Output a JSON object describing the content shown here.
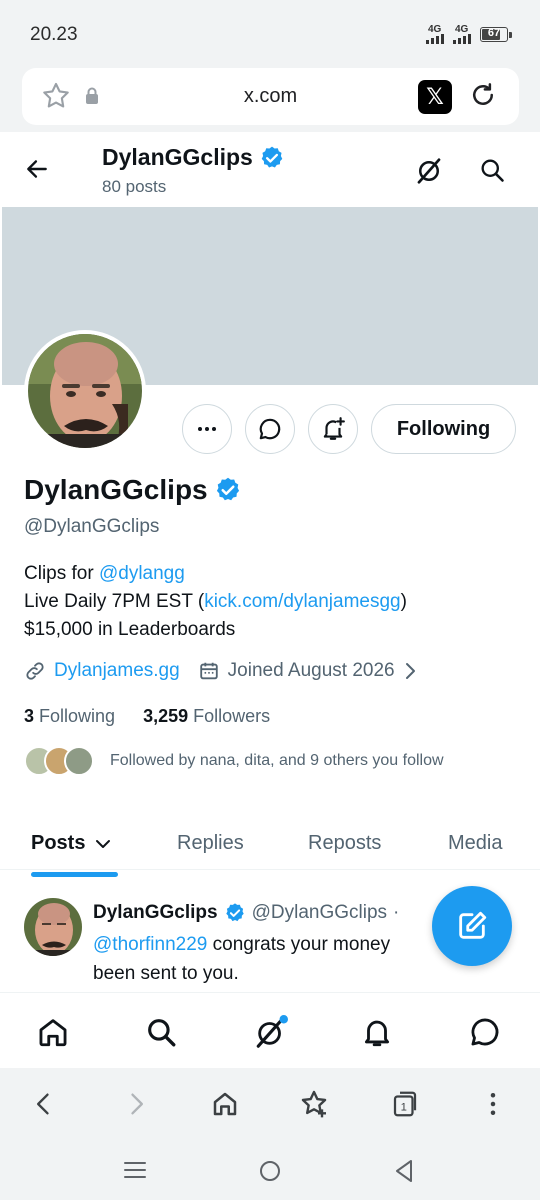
{
  "status": {
    "time": "20.23",
    "net1": "4G",
    "net2": "4G",
    "battery": "67"
  },
  "browser": {
    "url": "x.com",
    "tabs_count": "1"
  },
  "header": {
    "display_name": "DylanGGclips",
    "posts_count": "80 posts"
  },
  "profile": {
    "display_name": "DylanGGclips",
    "handle": "@DylanGGclips",
    "follow_button": "Following",
    "bio": {
      "line1_prefix": "Clips for ",
      "line1_link": "@dylangg",
      "line2_prefix": "Live Daily 7PM EST (",
      "line2_link": "kick.com/dylanjamesgg",
      "line2_suffix": ")",
      "line3": "$15,000 in Leaderboards"
    },
    "website": "Dylanjames.gg",
    "joined": "Joined August 2026",
    "following_count": "3",
    "following_label": "Following",
    "followers_count": "3,259",
    "followers_label": "Followers",
    "followed_by": "Followed by nana, dita, and 9 others you follow"
  },
  "tabs": [
    {
      "label": "Posts"
    },
    {
      "label": "Replies"
    },
    {
      "label": "Reposts"
    },
    {
      "label": "Media"
    }
  ],
  "tweet": {
    "name": "DylanGGclips",
    "handle": "@DylanGGclips",
    "dot": "·",
    "mention": "@thorfinn229",
    "text_part1": " congrats your money ",
    "text_part2": "been sent to you."
  },
  "colors": {
    "accent": "#1d9bf0",
    "banner": "#cfd9de",
    "text": "#0f1419",
    "muted": "#536471"
  }
}
